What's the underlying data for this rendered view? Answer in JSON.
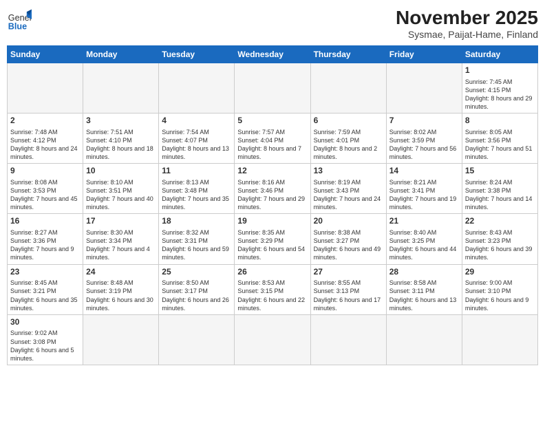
{
  "header": {
    "logo_general": "General",
    "logo_blue": "Blue",
    "month_title": "November 2025",
    "location": "Sysmae, Paijat-Hame, Finland"
  },
  "days_of_week": [
    "Sunday",
    "Monday",
    "Tuesday",
    "Wednesday",
    "Thursday",
    "Friday",
    "Saturday"
  ],
  "weeks": [
    [
      {
        "day": "",
        "info": ""
      },
      {
        "day": "",
        "info": ""
      },
      {
        "day": "",
        "info": ""
      },
      {
        "day": "",
        "info": ""
      },
      {
        "day": "",
        "info": ""
      },
      {
        "day": "",
        "info": ""
      },
      {
        "day": "1",
        "info": "Sunrise: 7:45 AM\nSunset: 4:15 PM\nDaylight: 8 hours\nand 29 minutes."
      }
    ],
    [
      {
        "day": "2",
        "info": "Sunrise: 7:48 AM\nSunset: 4:12 PM\nDaylight: 8 hours\nand 24 minutes."
      },
      {
        "day": "3",
        "info": "Sunrise: 7:51 AM\nSunset: 4:10 PM\nDaylight: 8 hours\nand 18 minutes."
      },
      {
        "day": "4",
        "info": "Sunrise: 7:54 AM\nSunset: 4:07 PM\nDaylight: 8 hours\nand 13 minutes."
      },
      {
        "day": "5",
        "info": "Sunrise: 7:57 AM\nSunset: 4:04 PM\nDaylight: 8 hours\nand 7 minutes."
      },
      {
        "day": "6",
        "info": "Sunrise: 7:59 AM\nSunset: 4:01 PM\nDaylight: 8 hours\nand 2 minutes."
      },
      {
        "day": "7",
        "info": "Sunrise: 8:02 AM\nSunset: 3:59 PM\nDaylight: 7 hours\nand 56 minutes."
      },
      {
        "day": "8",
        "info": "Sunrise: 8:05 AM\nSunset: 3:56 PM\nDaylight: 7 hours\nand 51 minutes."
      }
    ],
    [
      {
        "day": "9",
        "info": "Sunrise: 8:08 AM\nSunset: 3:53 PM\nDaylight: 7 hours\nand 45 minutes."
      },
      {
        "day": "10",
        "info": "Sunrise: 8:10 AM\nSunset: 3:51 PM\nDaylight: 7 hours\nand 40 minutes."
      },
      {
        "day": "11",
        "info": "Sunrise: 8:13 AM\nSunset: 3:48 PM\nDaylight: 7 hours\nand 35 minutes."
      },
      {
        "day": "12",
        "info": "Sunrise: 8:16 AM\nSunset: 3:46 PM\nDaylight: 7 hours\nand 29 minutes."
      },
      {
        "day": "13",
        "info": "Sunrise: 8:19 AM\nSunset: 3:43 PM\nDaylight: 7 hours\nand 24 minutes."
      },
      {
        "day": "14",
        "info": "Sunrise: 8:21 AM\nSunset: 3:41 PM\nDaylight: 7 hours\nand 19 minutes."
      },
      {
        "day": "15",
        "info": "Sunrise: 8:24 AM\nSunset: 3:38 PM\nDaylight: 7 hours\nand 14 minutes."
      }
    ],
    [
      {
        "day": "16",
        "info": "Sunrise: 8:27 AM\nSunset: 3:36 PM\nDaylight: 7 hours\nand 9 minutes."
      },
      {
        "day": "17",
        "info": "Sunrise: 8:30 AM\nSunset: 3:34 PM\nDaylight: 7 hours\nand 4 minutes."
      },
      {
        "day": "18",
        "info": "Sunrise: 8:32 AM\nSunset: 3:31 PM\nDaylight: 6 hours\nand 59 minutes."
      },
      {
        "day": "19",
        "info": "Sunrise: 8:35 AM\nSunset: 3:29 PM\nDaylight: 6 hours\nand 54 minutes."
      },
      {
        "day": "20",
        "info": "Sunrise: 8:38 AM\nSunset: 3:27 PM\nDaylight: 6 hours\nand 49 minutes."
      },
      {
        "day": "21",
        "info": "Sunrise: 8:40 AM\nSunset: 3:25 PM\nDaylight: 6 hours\nand 44 minutes."
      },
      {
        "day": "22",
        "info": "Sunrise: 8:43 AM\nSunset: 3:23 PM\nDaylight: 6 hours\nand 39 minutes."
      }
    ],
    [
      {
        "day": "23",
        "info": "Sunrise: 8:45 AM\nSunset: 3:21 PM\nDaylight: 6 hours\nand 35 minutes."
      },
      {
        "day": "24",
        "info": "Sunrise: 8:48 AM\nSunset: 3:19 PM\nDaylight: 6 hours\nand 30 minutes."
      },
      {
        "day": "25",
        "info": "Sunrise: 8:50 AM\nSunset: 3:17 PM\nDaylight: 6 hours\nand 26 minutes."
      },
      {
        "day": "26",
        "info": "Sunrise: 8:53 AM\nSunset: 3:15 PM\nDaylight: 6 hours\nand 22 minutes."
      },
      {
        "day": "27",
        "info": "Sunrise: 8:55 AM\nSunset: 3:13 PM\nDaylight: 6 hours\nand 17 minutes."
      },
      {
        "day": "28",
        "info": "Sunrise: 8:58 AM\nSunset: 3:11 PM\nDaylight: 6 hours\nand 13 minutes."
      },
      {
        "day": "29",
        "info": "Sunrise: 9:00 AM\nSunset: 3:10 PM\nDaylight: 6 hours\nand 9 minutes."
      }
    ],
    [
      {
        "day": "30",
        "info": "Sunrise: 9:02 AM\nSunset: 3:08 PM\nDaylight: 6 hours\nand 5 minutes."
      },
      {
        "day": "",
        "info": ""
      },
      {
        "day": "",
        "info": ""
      },
      {
        "day": "",
        "info": ""
      },
      {
        "day": "",
        "info": ""
      },
      {
        "day": "",
        "info": ""
      },
      {
        "day": "",
        "info": ""
      }
    ]
  ]
}
